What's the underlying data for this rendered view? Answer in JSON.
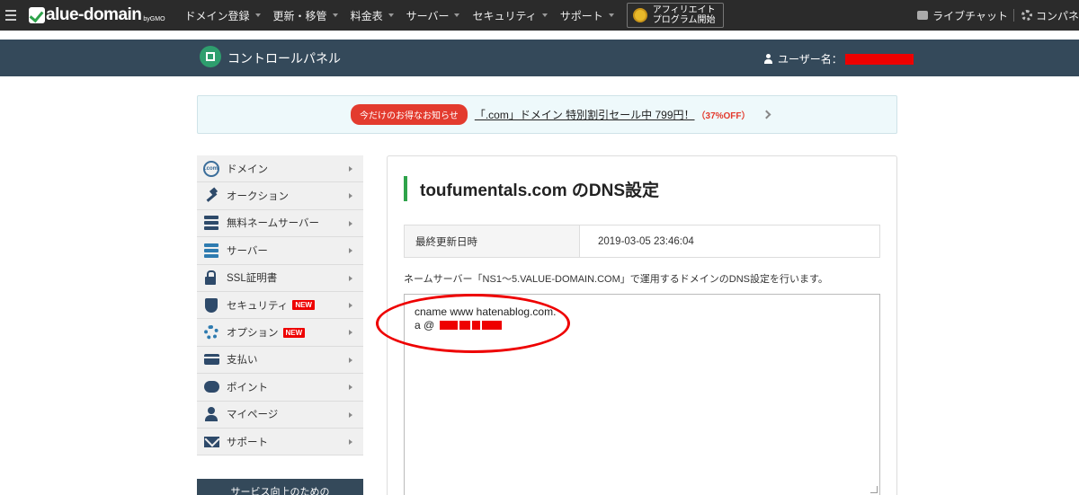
{
  "topbar": {
    "logo_text": "alue-domain",
    "logo_by": "byGMO",
    "nav": [
      {
        "label": "ドメイン登録"
      },
      {
        "label": "更新・移管"
      },
      {
        "label": "料金表"
      },
      {
        "label": "サーバー"
      },
      {
        "label": "セキュリティ"
      },
      {
        "label": "サポート"
      }
    ],
    "affiliate_line1": "アフィリエイト",
    "affiliate_line2": "プログラム開始",
    "live_chat": "ライブチャット",
    "control_panel": "コンパネ"
  },
  "subbar": {
    "title": "コントロールパネル",
    "user_label": "ユーザー名："
  },
  "notice": {
    "badge": "今だけのお得なお知らせ",
    "link": "「.com」ドメイン 特別割引セール中 799円！",
    "discount": "（37%OFF）"
  },
  "sidebar": {
    "items": [
      {
        "label": "ドメイン",
        "icon": "com-globe-icon"
      },
      {
        "label": "オークション",
        "icon": "hammer-icon"
      },
      {
        "label": "無料ネームサーバー",
        "icon": "server-icon"
      },
      {
        "label": "サーバー",
        "icon": "server-icon"
      },
      {
        "label": "SSL証明書",
        "icon": "lock-icon"
      },
      {
        "label": "セキュリティ",
        "icon": "shield-icon",
        "badge": "NEW"
      },
      {
        "label": "オプション",
        "icon": "gears-icon",
        "badge": "NEW"
      },
      {
        "label": "支払い",
        "icon": "card-icon"
      },
      {
        "label": "ポイント",
        "icon": "piggy-bank-icon"
      },
      {
        "label": "マイページ",
        "icon": "person-icon"
      },
      {
        "label": "サポート",
        "icon": "mail-icon"
      }
    ],
    "bottom_box": "サービス向上のための"
  },
  "main": {
    "title": "toufumentals.com のDNS設定",
    "updated_label": "最終更新日時",
    "updated_value": "2019-03-05 23:46:04",
    "description": "ネームサーバー「NS1～5.VALUE-DOMAIN.COM」で運用するドメインのDNS設定を行います。",
    "dns_line1": "cname www hatenablog.com.",
    "dns_line2_prefix": "a @"
  },
  "colors": {
    "topbar": "#2b2b2b",
    "subbar": "#34495a",
    "accent_green": "#2ea34a",
    "badge_red": "#e33b2e",
    "annotation_red": "#e00"
  }
}
